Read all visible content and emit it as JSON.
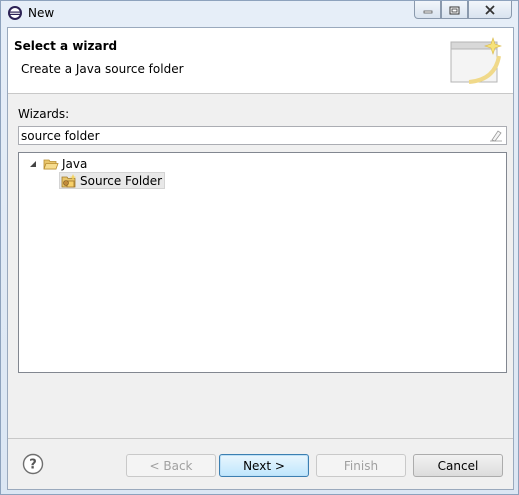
{
  "window": {
    "title": "New"
  },
  "header": {
    "title": "Select a wizard",
    "description": "Create a Java source folder"
  },
  "wizards": {
    "label": "Wizards:",
    "filter_value": "source folder",
    "tree": [
      {
        "label": "Java",
        "expanded": true,
        "icon": "folder-open-icon"
      },
      {
        "label": "Source Folder",
        "selected": true,
        "icon": "source-folder-icon"
      }
    ]
  },
  "buttons": {
    "back": "< Back",
    "next": "Next >",
    "finish": "Finish",
    "cancel": "Cancel"
  },
  "colors": {
    "default_button_border": "#3c7fb1",
    "disabled_text": "#a0a0a0"
  }
}
